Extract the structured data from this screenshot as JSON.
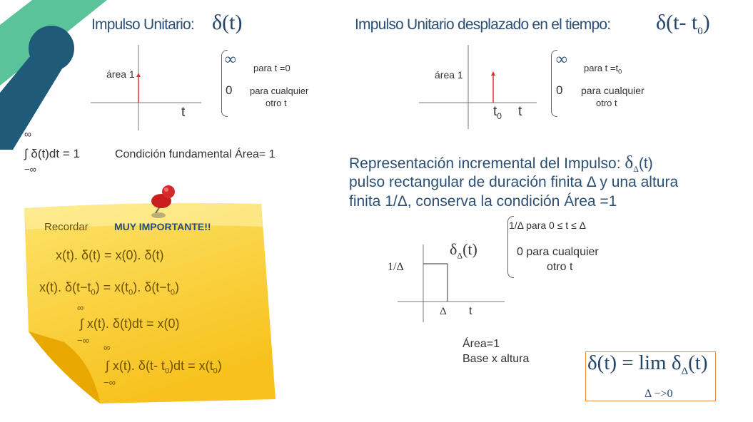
{
  "theme": {
    "green": "#5bc39a",
    "navy": "#1f5a78",
    "note_yellow": "#fde36a",
    "pin_red": "#d42a2a",
    "orange": "#f08a3c"
  },
  "left_top": {
    "title": "Impulso Unitario:",
    "symbol": "δ(t)",
    "area_label": "área 1",
    "t_label": "t",
    "case1_value": "∞",
    "case1_cond": "para  t =0",
    "case2_value": "0",
    "case2_cond_1": "para cualquier",
    "case2_cond_2": "otro t"
  },
  "integral": {
    "upper": "∞",
    "expr": "∫ δ(t)dt = 1",
    "lower": "−∞",
    "caption": "Condición fundamental Área= 1"
  },
  "right_top": {
    "title": "Impulso Unitario desplazado en el tiempo:",
    "symbol": "δ(t- t",
    "symbol_sub": "0",
    "symbol_close": ")",
    "area_label": "área 1",
    "t0_label": "t",
    "t0_sub": "0",
    "t_label": "t",
    "case1_value": "∞",
    "case1_cond": "para  t =t",
    "case1_sub": "0",
    "case2_value": "0",
    "case2_cond_1": "para cualquier",
    "case2_cond_2": "otro t"
  },
  "note": {
    "recordar": "Recordar",
    "importante": "MUY IMPORTANTE!!",
    "eq1": "x(t). δ(t) = x(0). δ(t)",
    "eq2_a": "x(t). δ(t−t",
    "eq2_sub1": "0",
    "eq2_b": ") = x(t",
    "eq2_sub2": "0",
    "eq2_c": "). δ(t−t",
    "eq2_sub3": "0",
    "eq2_d": ")",
    "eq3_upper": "∞",
    "eq3": "∫ x(t). δ(t)dt = x(0)",
    "eq3_lower": "−∞",
    "eq4_upper": "∞",
    "eq4_a": "∫ x(t). δ(t- t",
    "eq4_sub1": "0",
    "eq4_b": ")dt = x(t",
    "eq4_sub2": "0",
    "eq4_c": ")",
    "eq4_lower": "−∞"
  },
  "incremental": {
    "line1": "Representación incremental del Impulso:",
    "line1_sym": "δ",
    "line1_sub": "Δ",
    "line1_arg": "(t)",
    "line2": "pulso rectangular de duración finita Δ y una altura",
    "line3": "finita 1/Δ, conserva la condición Área =1",
    "case1": "1/Δ  para  0 ≤ t ≤ Δ",
    "case2_1": "0  para cualquier",
    "case2_2": "otro t",
    "func": "δ",
    "func_sub": "Δ",
    "func_arg": "(t)",
    "height_label": "1/Δ",
    "delta_label": "Δ",
    "t_label": "t",
    "area": "Área=1",
    "base": "Base x altura",
    "lim_expr": "δ(t) = lim δ",
    "lim_sub": "Δ",
    "lim_arg": "(t)",
    "lim_cond": "Δ −>0"
  }
}
